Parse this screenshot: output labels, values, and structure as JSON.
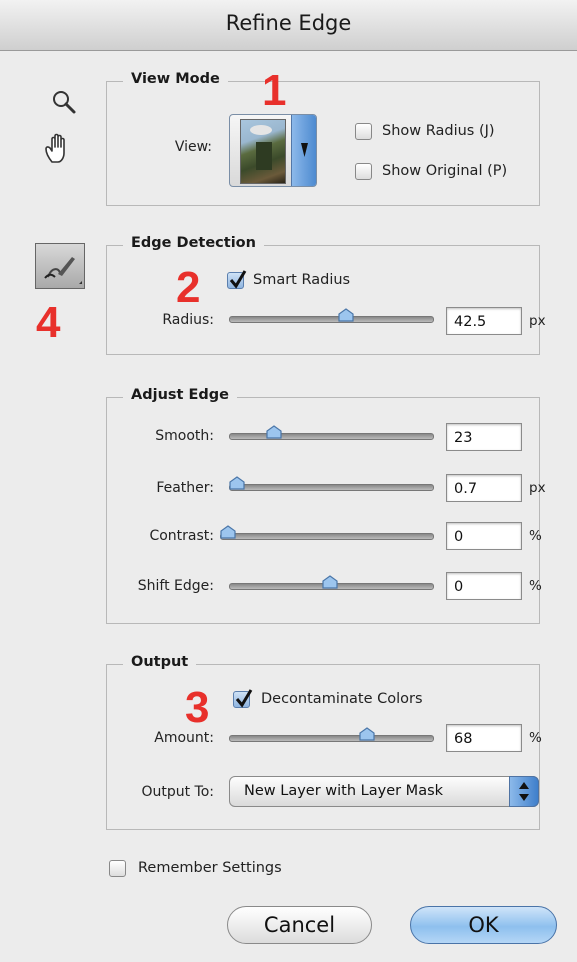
{
  "window": {
    "title": "Refine Edge"
  },
  "view_mode": {
    "legend": "View Mode",
    "view_label": "View:",
    "show_radius_label": "Show Radius (J)",
    "show_original_label": "Show Original (P)",
    "show_radius_checked": false,
    "show_original_checked": false
  },
  "edge_detection": {
    "legend": "Edge Detection",
    "smart_radius_label": "Smart Radius",
    "smart_radius_checked": true,
    "radius_label": "Radius:",
    "radius_value": "42.5",
    "radius_unit": "px"
  },
  "adjust_edge": {
    "legend": "Adjust Edge",
    "smooth_label": "Smooth:",
    "smooth_value": "23",
    "feather_label": "Feather:",
    "feather_value": "0.7",
    "feather_unit": "px",
    "contrast_label": "Contrast:",
    "contrast_value": "0",
    "contrast_unit": "%",
    "shift_label": "Shift Edge:",
    "shift_value": "0",
    "shift_unit": "%"
  },
  "output": {
    "legend": "Output",
    "decontaminate_label": "Decontaminate Colors",
    "decontaminate_checked": true,
    "amount_label": "Amount:",
    "amount_value": "68",
    "amount_unit": "%",
    "output_to_label": "Output To:",
    "output_to_value": "New Layer with Layer Mask"
  },
  "footer": {
    "remember_label": "Remember Settings",
    "remember_checked": false,
    "cancel_label": "Cancel",
    "ok_label": "OK"
  },
  "callouts": {
    "c1": "1",
    "c2": "2",
    "c3": "3",
    "c4": "4"
  },
  "icons": [
    "zoom-tool-icon",
    "hand-tool-icon",
    "refine-radius-brush-icon",
    "dropdown-arrow-icon",
    "stepper-arrows-icon"
  ],
  "colors": {
    "callout": "#e8302b",
    "ok_button": "#8ec0ee",
    "checkbox_on": "#8fb4df"
  }
}
